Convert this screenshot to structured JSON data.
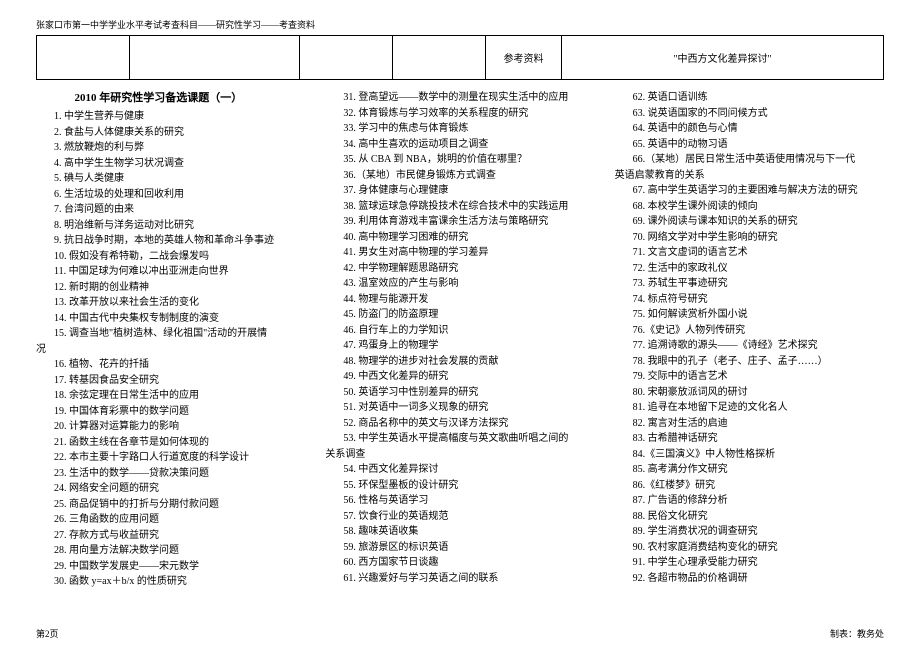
{
  "header": "张家口市第一中学学业水平考试考查科目——研究性学习——考查资料",
  "table": {
    "ref_label": "参考资料",
    "ref_value": "\"中西方文化差异探讨\""
  },
  "title": "2010 年研究性学习备选课题（一）",
  "items": [
    "1. 中学生营养与健康",
    "2. 食盐与人体健康关系的研究",
    "3. 燃放鞭炮的利与弊",
    "4. 高中学生生物学习状况调查",
    "5. 碘与人类健康",
    "6. 生活垃圾的处理和回收利用",
    "7. 台湾问题的由来",
    "8. 明治维新与洋务运动对比研究",
    "9. 抗日战争时期，本地的英雄人物和革命斗争事迹",
    "10. 假如没有希特勒，二战会爆发吗",
    "11. 中国足球为何难以冲出亚洲走向世界",
    "12. 新时期的创业精神",
    "13. 改革开放以来社会生活的变化",
    "14. 中国古代中央集权专制制度的演变",
    "15. 调查当地\"植树造林、绿化祖国\"活动的开展情",
    "况",
    "16. 植物、花卉的扦插",
    "17. 转基因食品安全研究",
    "18. 余弦定理在日常生活中的应用",
    "19. 中国体育彩票中的数学问题",
    "20. 计算器对运算能力的影响",
    "21. 函数主线在各章节是如何体现的",
    "22. 本市主要十字路口人行道宽度的科学设计",
    "23. 生活中的数学——贷款决策问题",
    "24.  网络安全问题的研究",
    "25. 商品促销中的打折与分期付款问题",
    "26. 三角函数的应用问题",
    "27. 存款方式与收益研究",
    "28. 用向量方法解决数学问题",
    "29. 中国数学发展史——宋元数学",
    "30. 函数 y=ax＋b/x 的性质研究",
    "31. 登高望远——数学中的测量在现实生活中的应用",
    "32. 体育锻炼与学习效率的关系程度的研究",
    "33. 学习中的焦虑与体育锻炼",
    "34. 高中生喜欢的运动项目之调查",
    "35. 从 CBA 到 NBA，姚明的价值在哪里？",
    "36.（某地）市民健身锻炼方式调查",
    "37. 身体健康与心理健康",
    "38. 篮球运球急停跳投技术在综合技术中的实践运用",
    "39. 利用体育游戏丰富课余生活方法与策略研究",
    "40. 高中物理学习困难的研究",
    "41. 男女生对高中物理的学习差异",
    "42. 中学物理解题思路研究",
    "43. 温室效应的产生与影响",
    "44. 物理与能源开发",
    "45. 防盗门的防盗原理",
    "46. 自行车上的力学知识",
    "47. 鸡蛋身上的物理学",
    "48. 物理学的进步对社会发展的贡献",
    "49. 中西文化差异的研究",
    "50. 英语学习中性别差异的研究",
    "51. 对英语中一词多义现象的研究",
    "52. 商品名称中的英文与汉译方法探究",
    "53. 中学生英语水平提高幅度与英文歌曲听唱之间的",
    "关系调查",
    "54. 中西文化差异探讨",
    "55. 环保型墨板的设计研究",
    "56. 性格与英语学习",
    "57. 饮食行业的英语规范",
    "58. 趣味英语收集",
    "59. 旅游景区的标识英语",
    "60. 西方国家节日谈趣",
    "61. 兴趣爱好与学习英语之间的联系",
    "62. 英语口语训练",
    "63. 说英语国家的不同问候方式",
    "64. 英语中的颜色与心情",
    "65. 英语中的动物习语",
    "66.（某地）居民日常生活中英语使用情况与下一代",
    "英语启蒙教育的关系",
    "67. 高中学生英语学习的主要困难与解决方法的研究",
    "68. 本校学生课外阅读的倾向",
    "69. 课外阅读与课本知识的关系的研究",
    "70. 网络文学对中学生影响的研究",
    "71. 文言文虚词的语言艺术",
    "72. 生活中的家政礼仪",
    "73. 苏轼生平事迹研究",
    "74. 标点符号研究",
    "75. 如何解读赏析外国小说",
    "76.《史记》人物列传研究",
    "77. 追溯诗歌的源头——《诗经》艺术探究",
    "78. 我眼中的孔子（老子、庄子、孟子……）",
    "79. 交际中的语言艺术",
    "80. 宋朝豪放派词风的研讨",
    "81. 追寻在本地留下足迹的文化名人",
    "82. 寓言对生活的启迪",
    "83. 古希腊神话研究",
    "84.《三国演义》中人物性格探析",
    "85. 高考满分作文研究",
    "86.《红楼梦》研究",
    "87. 广告语的修辞分析",
    "88. 民俗文化研究",
    "89. 学生消费状况的调查研究",
    "90. 农村家庭消费结构变化的研究",
    "91. 中学生心理承受能力研究",
    "92. 各超市物品的价格调研"
  ],
  "footer": {
    "left": "第2页",
    "right": "制表：教务处"
  }
}
